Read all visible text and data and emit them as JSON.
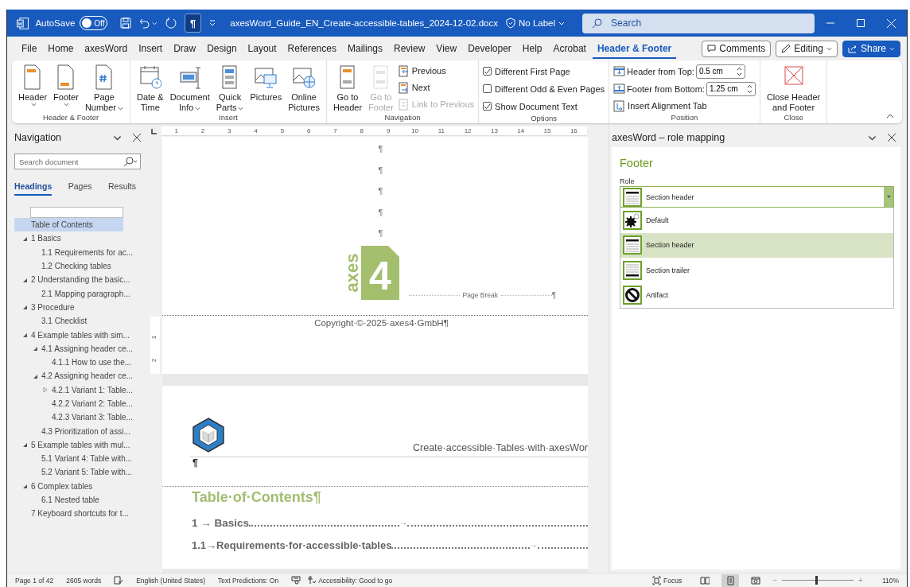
{
  "title_bar": {
    "autosave_label": "AutoSave",
    "autosave_on": false,
    "autosave_state": "Off",
    "formatting_marks_on": true,
    "formatting_marks_symbol": "¶",
    "filename": "axesWord_Guide_EN_Create-accessible-tables_2024-12-02.docx",
    "sensitivity": "No Label",
    "search_placeholder": "Search"
  },
  "menu_tabs": [
    {
      "label": "File",
      "selected": false
    },
    {
      "label": "Home",
      "selected": false
    },
    {
      "label": "axesWord",
      "selected": false
    },
    {
      "label": "Insert",
      "selected": false
    },
    {
      "label": "Draw",
      "selected": false
    },
    {
      "label": "Design",
      "selected": false
    },
    {
      "label": "Layout",
      "selected": false
    },
    {
      "label": "References",
      "selected": false
    },
    {
      "label": "Mailings",
      "selected": false
    },
    {
      "label": "Review",
      "selected": false
    },
    {
      "label": "View",
      "selected": false
    },
    {
      "label": "Developer",
      "selected": false
    },
    {
      "label": "Help",
      "selected": false
    },
    {
      "label": "Acrobat",
      "selected": false
    },
    {
      "label": "Header & Footer",
      "selected": true
    }
  ],
  "menu_buttons": [
    {
      "kind": "comments",
      "label": "Comments"
    },
    {
      "kind": "editing",
      "label": "Editing"
    },
    {
      "kind": "share",
      "label": "Share"
    }
  ],
  "ribbon_groups": [
    {
      "name": "Header & Footer",
      "items": [
        {
          "kind": "large",
          "lines": [
            "Header"
          ],
          "dropdown": true,
          "disabled": false
        },
        {
          "kind": "large",
          "lines": [
            "Footer"
          ],
          "dropdown": true,
          "disabled": false
        },
        {
          "kind": "large",
          "lines": [
            "Page",
            "Number"
          ],
          "dropdown": true,
          "disabled": false
        }
      ]
    },
    {
      "name": "Insert",
      "items": [
        {
          "kind": "large",
          "lines": [
            "Date &",
            "Time"
          ],
          "dropdown": false,
          "disabled": false
        },
        {
          "kind": "large",
          "lines": [
            "Document",
            "Info"
          ],
          "dropdown": true,
          "disabled": false
        },
        {
          "kind": "large",
          "lines": [
            "Quick",
            "Parts"
          ],
          "dropdown": true,
          "disabled": false
        },
        {
          "kind": "large",
          "lines": [
            "Pictures"
          ],
          "dropdown": false,
          "disabled": false
        },
        {
          "kind": "large",
          "lines": [
            "Online",
            "Pictures"
          ],
          "dropdown": false,
          "disabled": false
        }
      ]
    },
    {
      "name": "Navigation",
      "items": [
        {
          "kind": "large",
          "lines": [
            "Go to",
            "Header"
          ],
          "dropdown": false,
          "disabled": false
        },
        {
          "kind": "large",
          "lines": [
            "Go to",
            "Footer"
          ],
          "dropdown": false,
          "disabled": true
        },
        {
          "kind": "small",
          "label": "Previous",
          "disabled": false
        },
        {
          "kind": "small",
          "label": "Next",
          "disabled": false
        },
        {
          "kind": "small",
          "label": "Link to Previous",
          "disabled": true
        }
      ]
    },
    {
      "name": "Options",
      "items": [
        {
          "kind": "check",
          "label": "Different First Page",
          "checked": true
        },
        {
          "kind": "check",
          "label": "Different Odd & Even Pages",
          "checked": false
        },
        {
          "kind": "check",
          "label": "Show Document Text",
          "checked": true
        }
      ]
    },
    {
      "name": "Position",
      "items": [
        {
          "kind": "spin",
          "label": "Header from Top:",
          "value": "0.5 cm"
        },
        {
          "kind": "spin",
          "label": "Footer from Bottom:",
          "value": "1.25 cm"
        },
        {
          "kind": "small",
          "label": "Insert Alignment Tab",
          "disabled": false
        }
      ]
    },
    {
      "name": "Close",
      "items": [
        {
          "kind": "large",
          "lines": [
            "Close Header",
            "and Footer"
          ],
          "dropdown": false,
          "disabled": false
        }
      ]
    }
  ],
  "navigation": {
    "title": "Navigation",
    "search_placeholder": "Search document",
    "tabs": [
      {
        "label": "Headings",
        "selected": true
      },
      {
        "label": "Pages",
        "selected": false
      },
      {
        "label": "Results",
        "selected": false
      }
    ],
    "headings": [
      {
        "label": "Table of Contents",
        "selected": true
      },
      {
        "label": "1 Basics",
        "selected": false,
        "expanded": true,
        "children": [
          {
            "label": "1.1 Requirements for ac...",
            "selected": false
          },
          {
            "label": "1.2 Checking tables",
            "selected": false
          }
        ]
      },
      {
        "label": "2 Understanding the basic...",
        "selected": false,
        "expanded": true,
        "children": [
          {
            "label": "2.1 Mapping paragraph...",
            "selected": false
          }
        ]
      },
      {
        "label": "3 Procedure",
        "selected": false,
        "expanded": true,
        "children": [
          {
            "label": "3.1 Checklist",
            "selected": false
          }
        ]
      },
      {
        "label": "4 Example tables with sim...",
        "selected": false,
        "expanded": true,
        "children": [
          {
            "label": "4.1 Assigning header ce...",
            "selected": false,
            "expanded": true,
            "children": [
              {
                "label": "4.1.1 How to use the...",
                "selected": false
              }
            ]
          },
          {
            "label": "4.2 Assigning header ce...",
            "selected": false,
            "expanded": true,
            "children": [
              {
                "label": "4.2.1 Variant 1: Table...",
                "selected": false,
                "expanded": false
              },
              {
                "label": "4.2.2 Variant 2: Table...",
                "selected": false
              },
              {
                "label": "4.2.3 Variant 3: Table...",
                "selected": false
              }
            ]
          },
          {
            "label": "4.3 Prioritization of assi...",
            "selected": false
          }
        ]
      },
      {
        "label": "5 Example tables with mul...",
        "selected": false,
        "expanded": true,
        "children": [
          {
            "label": "5.1 Variant 4: Table with...",
            "selected": false
          },
          {
            "label": "5.2 Variant 5: Table with...",
            "selected": false
          }
        ]
      },
      {
        "label": "6 Complex tables",
        "selected": false,
        "expanded": true,
        "children": [
          {
            "label": "6.1 Nested table",
            "selected": false
          }
        ]
      },
      {
        "label": "7 Keyboard shortcuts for t...",
        "selected": false
      }
    ]
  },
  "rulers": {
    "horizontal": [
      "1",
      "2",
      "3",
      "4",
      "5",
      "6",
      "7",
      "8",
      "9",
      "10",
      "11",
      "12",
      "13",
      "14",
      "15",
      "16"
    ],
    "vertical": [
      "1",
      "2"
    ]
  },
  "document": {
    "page1": {
      "marks": [
        "¶",
        "¶",
        "¶",
        "¶",
        "¶"
      ],
      "logo_word": "axes",
      "logo_numeral": "4",
      "page_break": "Page Break",
      "page_break_mark": "¶",
      "footer_text": "Copyright·©·2025·axes4·GmbH¶"
    },
    "page2": {
      "header_text": "Create·accessible·Tables·with·axesWor",
      "header_mark": "¶",
      "toc_title": "Table·of·Contents¶",
      "toc_entries": [
        {
          "kind": "level1",
          "text": "1 → Basics",
          "tab": "→"
        },
        {
          "kind": "level2",
          "text": "1.1→Requirements·for·accessible·tables",
          "tab": "→"
        }
      ]
    }
  },
  "role_panel": {
    "title": "axesWord – role mapping",
    "heading": "Footer",
    "field_label": "Role",
    "value": "Section header",
    "open": true,
    "options": [
      {
        "kind": "default",
        "label": "Default",
        "selected": false
      },
      {
        "kind": "section_header",
        "label": "Section header",
        "selected": true
      },
      {
        "kind": "section_trailer",
        "label": "Section trailer",
        "selected": false
      },
      {
        "kind": "artifact",
        "label": "Artifact",
        "selected": false
      }
    ]
  },
  "status_bar": {
    "page": "Page 1 of 42",
    "words": "2605 words",
    "language": "English (United States)",
    "predictions": "Text Predictions: On",
    "accessibility": "Accessibility: Good to go",
    "focus": "Focus",
    "views": [
      {
        "selected": false
      },
      {
        "selected": true
      },
      {
        "selected": false
      }
    ],
    "zoom": {
      "minus": "−",
      "plus": "+",
      "level": 0.47,
      "text": "110%"
    }
  }
}
